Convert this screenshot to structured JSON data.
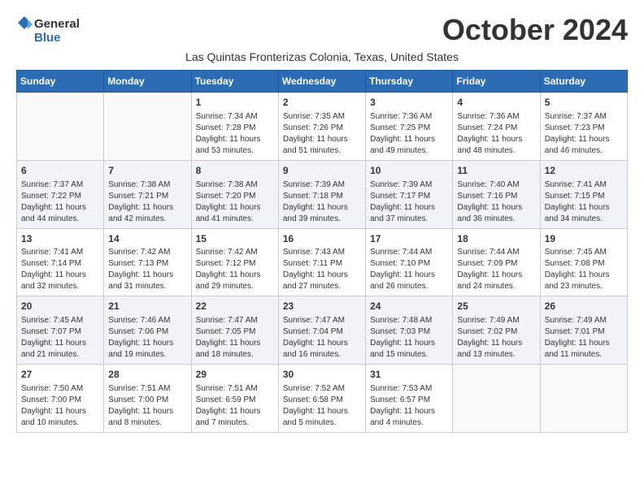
{
  "logo": {
    "general": "General",
    "blue": "Blue"
  },
  "title": "October 2024",
  "subtitle": "Las Quintas Fronterizas Colonia, Texas, United States",
  "days_of_week": [
    "Sunday",
    "Monday",
    "Tuesday",
    "Wednesday",
    "Thursday",
    "Friday",
    "Saturday"
  ],
  "weeks": [
    [
      {
        "day": "",
        "info": ""
      },
      {
        "day": "",
        "info": ""
      },
      {
        "day": "1",
        "info": "Sunrise: 7:34 AM\nSunset: 7:28 PM\nDaylight: 11 hours and 53 minutes."
      },
      {
        "day": "2",
        "info": "Sunrise: 7:35 AM\nSunset: 7:26 PM\nDaylight: 11 hours and 51 minutes."
      },
      {
        "day": "3",
        "info": "Sunrise: 7:36 AM\nSunset: 7:25 PM\nDaylight: 11 hours and 49 minutes."
      },
      {
        "day": "4",
        "info": "Sunrise: 7:36 AM\nSunset: 7:24 PM\nDaylight: 11 hours and 48 minutes."
      },
      {
        "day": "5",
        "info": "Sunrise: 7:37 AM\nSunset: 7:23 PM\nDaylight: 11 hours and 46 minutes."
      }
    ],
    [
      {
        "day": "6",
        "info": "Sunrise: 7:37 AM\nSunset: 7:22 PM\nDaylight: 11 hours and 44 minutes."
      },
      {
        "day": "7",
        "info": "Sunrise: 7:38 AM\nSunset: 7:21 PM\nDaylight: 11 hours and 42 minutes."
      },
      {
        "day": "8",
        "info": "Sunrise: 7:38 AM\nSunset: 7:20 PM\nDaylight: 11 hours and 41 minutes."
      },
      {
        "day": "9",
        "info": "Sunrise: 7:39 AM\nSunset: 7:18 PM\nDaylight: 11 hours and 39 minutes."
      },
      {
        "day": "10",
        "info": "Sunrise: 7:39 AM\nSunset: 7:17 PM\nDaylight: 11 hours and 37 minutes."
      },
      {
        "day": "11",
        "info": "Sunrise: 7:40 AM\nSunset: 7:16 PM\nDaylight: 11 hours and 36 minutes."
      },
      {
        "day": "12",
        "info": "Sunrise: 7:41 AM\nSunset: 7:15 PM\nDaylight: 11 hours and 34 minutes."
      }
    ],
    [
      {
        "day": "13",
        "info": "Sunrise: 7:41 AM\nSunset: 7:14 PM\nDaylight: 11 hours and 32 minutes."
      },
      {
        "day": "14",
        "info": "Sunrise: 7:42 AM\nSunset: 7:13 PM\nDaylight: 11 hours and 31 minutes."
      },
      {
        "day": "15",
        "info": "Sunrise: 7:42 AM\nSunset: 7:12 PM\nDaylight: 11 hours and 29 minutes."
      },
      {
        "day": "16",
        "info": "Sunrise: 7:43 AM\nSunset: 7:11 PM\nDaylight: 11 hours and 27 minutes."
      },
      {
        "day": "17",
        "info": "Sunrise: 7:44 AM\nSunset: 7:10 PM\nDaylight: 11 hours and 26 minutes."
      },
      {
        "day": "18",
        "info": "Sunrise: 7:44 AM\nSunset: 7:09 PM\nDaylight: 11 hours and 24 minutes."
      },
      {
        "day": "19",
        "info": "Sunrise: 7:45 AM\nSunset: 7:08 PM\nDaylight: 11 hours and 23 minutes."
      }
    ],
    [
      {
        "day": "20",
        "info": "Sunrise: 7:45 AM\nSunset: 7:07 PM\nDaylight: 11 hours and 21 minutes."
      },
      {
        "day": "21",
        "info": "Sunrise: 7:46 AM\nSunset: 7:06 PM\nDaylight: 11 hours and 19 minutes."
      },
      {
        "day": "22",
        "info": "Sunrise: 7:47 AM\nSunset: 7:05 PM\nDaylight: 11 hours and 18 minutes."
      },
      {
        "day": "23",
        "info": "Sunrise: 7:47 AM\nSunset: 7:04 PM\nDaylight: 11 hours and 16 minutes."
      },
      {
        "day": "24",
        "info": "Sunrise: 7:48 AM\nSunset: 7:03 PM\nDaylight: 11 hours and 15 minutes."
      },
      {
        "day": "25",
        "info": "Sunrise: 7:49 AM\nSunset: 7:02 PM\nDaylight: 11 hours and 13 minutes."
      },
      {
        "day": "26",
        "info": "Sunrise: 7:49 AM\nSunset: 7:01 PM\nDaylight: 11 hours and 11 minutes."
      }
    ],
    [
      {
        "day": "27",
        "info": "Sunrise: 7:50 AM\nSunset: 7:00 PM\nDaylight: 11 hours and 10 minutes."
      },
      {
        "day": "28",
        "info": "Sunrise: 7:51 AM\nSunset: 7:00 PM\nDaylight: 11 hours and 8 minutes."
      },
      {
        "day": "29",
        "info": "Sunrise: 7:51 AM\nSunset: 6:59 PM\nDaylight: 11 hours and 7 minutes."
      },
      {
        "day": "30",
        "info": "Sunrise: 7:52 AM\nSunset: 6:58 PM\nDaylight: 11 hours and 5 minutes."
      },
      {
        "day": "31",
        "info": "Sunrise: 7:53 AM\nSunset: 6:57 PM\nDaylight: 11 hours and 4 minutes."
      },
      {
        "day": "",
        "info": ""
      },
      {
        "day": "",
        "info": ""
      }
    ]
  ]
}
